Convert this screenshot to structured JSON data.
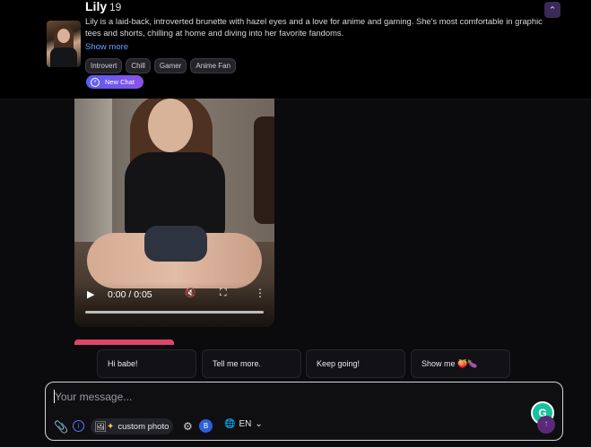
{
  "character": {
    "name": "Lily",
    "age": "19",
    "bio": "Lily is a laid-back, introverted brunette with hazel eyes and a love for anime and gaming. She's most comfortable in graphic tees and shorts, chilling at home and diving into her favorite fandoms.",
    "show_more": "Show more",
    "tags": [
      "Introvert",
      "Chill",
      "Gamer",
      "Anime Fan"
    ],
    "new_chat": "New Chat"
  },
  "video": {
    "time": "0:00 / 0:05",
    "progress": 0
  },
  "suggestions": [
    "Hi babe!",
    "Tell me more.",
    "Keep going!",
    "Show me 🍑🍆"
  ],
  "composer": {
    "placeholder": "Your message...",
    "custom_photo": "custom photo",
    "badge": "B",
    "language": "EN"
  },
  "icons": {
    "collapse": "chevron-up-icon",
    "new_chat": "chat-plus-icon",
    "attach": "paperclip-icon",
    "info": "info-icon",
    "image": "image-icon",
    "sparkle": "sparkle-icon",
    "settings": "gear-icon",
    "globe": "globe-icon",
    "send": "arrow-up-icon"
  },
  "colors": {
    "accent_start": "#5b5ef0",
    "accent_end": "#8a52e8",
    "link": "#6aa0ff",
    "pink": "#e0446c"
  }
}
